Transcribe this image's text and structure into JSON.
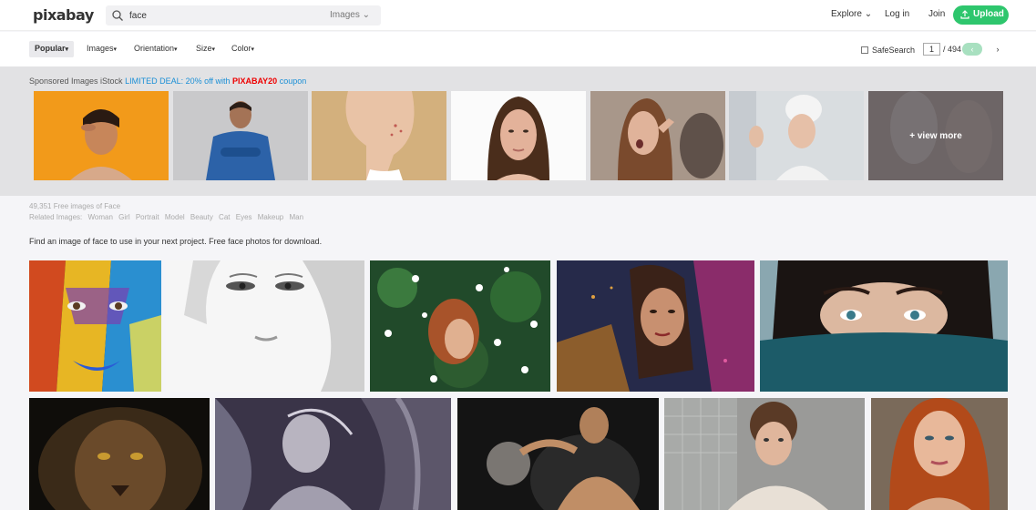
{
  "header": {
    "logo": "pixabay",
    "search_value": "face",
    "search_type": "Images",
    "nav": {
      "explore": "Explore",
      "login": "Log in",
      "join": "Join",
      "upload": "Upload"
    }
  },
  "filters": {
    "popular": "Popular",
    "images": "Images",
    "orientation": "Orientation",
    "size": "Size",
    "color": "Color",
    "safesearch": "SafeSearch",
    "page": "1",
    "total": "/ 494"
  },
  "sponsored": {
    "prefix": "Sponsored Images iStock",
    "deal": "LIMITED DEAL: 20% off with",
    "code": "PIXABAY20",
    "suffix": "coupon",
    "view_more": "+ view more"
  },
  "results": {
    "count": "49,351 Free images of Face",
    "related_label": "Related Images:",
    "related": [
      "Woman",
      "Girl",
      "Portrait",
      "Model",
      "Beauty",
      "Cat",
      "Eyes",
      "Makeup",
      "Man"
    ],
    "intro": "Find an image of face to use in your next project. Free face photos for download."
  },
  "colors": {
    "brand": "#2ec66d",
    "deal": "#1a8fd6",
    "code": "#ee0000"
  }
}
